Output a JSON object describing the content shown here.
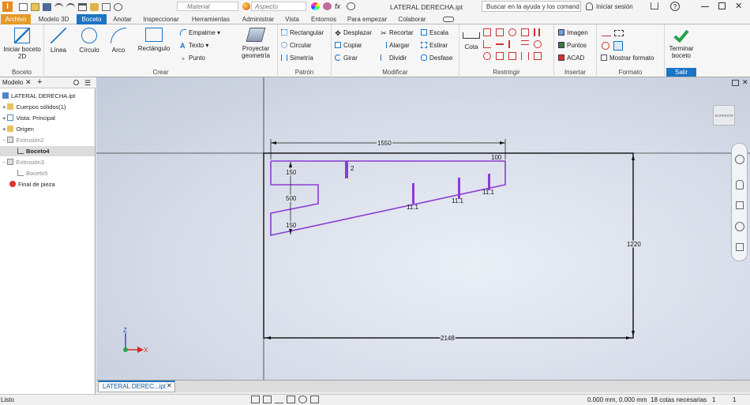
{
  "title_bar": {
    "material": "Material",
    "appearance": "Aspecto",
    "doc_title": "LATERAL DERECHA.ipt",
    "search_placeholder": "Buscar en la ayuda y los comand",
    "signin": "Iniciar sesión",
    "help": "?"
  },
  "tabs": [
    "Archivo",
    "Modelo 3D",
    "Boceto",
    "Anotar",
    "Inspeccionar",
    "Herramientas",
    "Administrar",
    "Vista",
    "Entornos",
    "Para empezar",
    "Colaborar"
  ],
  "ribbon": {
    "boceto": {
      "start": "Iniciar boceto 2D",
      "label": "Boceto"
    },
    "crear": {
      "linea": "Línea",
      "circulo": "Círculo",
      "arco": "Arco",
      "rectangulo": "Rectángulo",
      "empalme": "Empalme",
      "texto": "Texto",
      "punto": "Punto",
      "proyectar": "Proyectar geometría",
      "label": "Crear"
    },
    "patron": {
      "rectangular": "Rectangular",
      "circular": "Circular",
      "simetria": "Simetría",
      "label": "Patrón"
    },
    "modificar": {
      "desplazar": "Desplazar",
      "copiar": "Copiar",
      "girar": "Girar",
      "recortar": "Recortar",
      "alargar": "Alargar",
      "dividir": "Dividir",
      "escala": "Escala",
      "estirar": "Estirar",
      "desfase": "Desfase",
      "label": "Modificar"
    },
    "restringir": {
      "cota": "Cota",
      "label": "Restringir"
    },
    "insertar": {
      "imagen": "Imagen",
      "puntos": "Puntos",
      "acad": "ACAD",
      "label": "Insertar"
    },
    "formato": {
      "mostrar": "Mostrar formato",
      "label": "Formato"
    },
    "salir": {
      "terminar": "Terminar boceto",
      "label": "Salir"
    }
  },
  "browser": {
    "tab": "Modelo",
    "items": [
      "LATERAL DERECHA.ipt",
      "Cuerpos sólidos(1)",
      "Vista: Principal",
      "Origen",
      "Extrusión2",
      "Boceto4",
      "Extrusión3",
      "Boceto5",
      "Final de pieza"
    ]
  },
  "view_cube_label": "SUPERIOR",
  "sketch": {
    "dimensions": [
      "1550",
      "100",
      "150",
      "500",
      "150",
      "2",
      "11.1",
      "11.1",
      "11.1",
      "1220",
      "2148"
    ]
  },
  "axes": {
    "z": "Z",
    "x": "X"
  },
  "doc_tab": "LATERAL DEREC...ipt",
  "status": {
    "left": "Listo",
    "coords": "0.000 mm, 0.000 mm",
    "dims": "18 cotas necesarias",
    "n1": "1",
    "n2": "1"
  },
  "colors": {
    "active_tab": "#1c74c4",
    "sketch": "#8a3cd2",
    "finish": "#24a14a"
  }
}
